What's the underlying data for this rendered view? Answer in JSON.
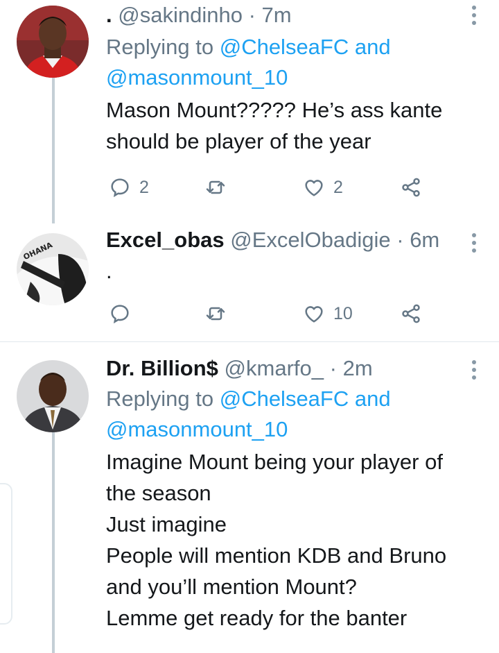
{
  "tweets": [
    {
      "display_name": ".",
      "handle": "@sakindinho",
      "time": "7m",
      "replying_prefix": "Replying to",
      "replying_to": "@ChelseaFC",
      "replying_and": "and",
      "replying_to_2": "@masonmount_10",
      "text_lines": [
        "Mason Mount????? He’s ass kante",
        "should be player of the year"
      ],
      "reply_count": "2",
      "retweet_count": "",
      "like_count": "2"
    },
    {
      "display_name": "Excel_obas",
      "handle": "@ExcelObadigie",
      "time": "6m",
      "text_lines": [
        "."
      ],
      "reply_count": "",
      "retweet_count": "",
      "like_count": "10"
    },
    {
      "display_name": "Dr. Billion$",
      "handle": "@kmarfo_",
      "time": "2m",
      "replying_prefix": "Replying to",
      "replying_to": "@ChelseaFC",
      "replying_and": "and",
      "replying_to_2": "@masonmount_10",
      "text_lines": [
        "Imagine Mount being your player of",
        "the season",
        "Just imagine",
        "People will mention KDB and Bruno",
        "and you’ll mention Mount?",
        "Lemme get ready for the banter"
      ]
    }
  ],
  "separator": "·",
  "avatar_text": "OHANA",
  "colors": {
    "link": "#1da1f2",
    "muted": "#657786",
    "icon": "#657786",
    "thread_line": "#c4cfd6"
  }
}
